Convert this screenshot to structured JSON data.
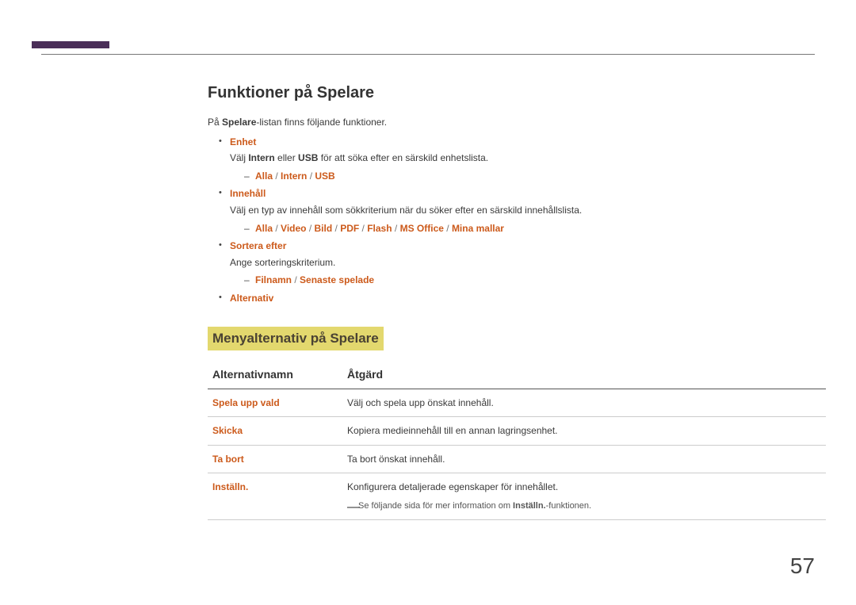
{
  "page_number": "57",
  "heading": "Funktioner på Spelare",
  "intro": {
    "pre": "På ",
    "bold": "Spelare",
    "post": "-listan finns följande funktioner."
  },
  "items": [
    {
      "title": "Enhet",
      "desc_pre": "Välj ",
      "desc_bold1": "Intern",
      "desc_mid": " eller ",
      "desc_bold2": "USB",
      "desc_post": " för att söka efter en särskild enhetslista.",
      "sub": [
        "Alla",
        "Intern",
        "USB"
      ]
    },
    {
      "title": "Innehåll",
      "desc": "Välj en typ av innehåll som sökkriterium när du söker efter en särskild innehållslista.",
      "sub": [
        "Alla",
        "Video",
        "Bild",
        "PDF",
        "Flash",
        "MS Office",
        "Mina mallar"
      ]
    },
    {
      "title": "Sortera efter",
      "desc": "Ange sorteringskriterium.",
      "sub": [
        "Filnamn",
        "Senaste spelade"
      ]
    },
    {
      "title": "Alternativ"
    }
  ],
  "subheading": "Menyalternativ på Spelare",
  "table": {
    "col1": "Alternativnamn",
    "col2": "Åtgärd",
    "rows": [
      {
        "name": "Spela upp vald",
        "desc": "Välj och spela upp önskat innehåll."
      },
      {
        "name": "Skicka",
        "desc": "Kopiera medieinnehåll till en annan lagringsenhet."
      },
      {
        "name": "Ta bort",
        "desc": "Ta bort önskat innehåll."
      },
      {
        "name": "Inställn.",
        "desc": "Konfigurera detaljerade egenskaper för innehållet."
      }
    ],
    "footnote_pre": "Se följande sida för mer information om ",
    "footnote_bold": "Inställn.",
    "footnote_post": "-funktionen."
  }
}
